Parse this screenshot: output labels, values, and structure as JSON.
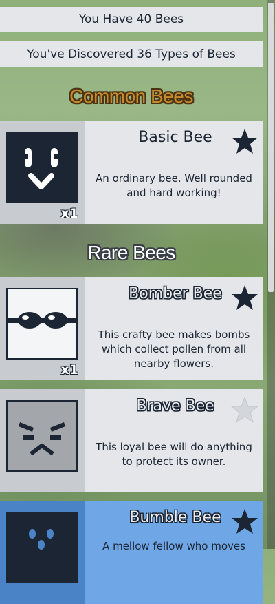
{
  "stats": {
    "bee_count_text": "You Have 40 Bees",
    "discovered_text": "You've Discovered 36 Types of Bees"
  },
  "sections": {
    "common_title": "Common Bees",
    "rare_title": "Rare Bees"
  },
  "bees": [
    {
      "name": "Basic Bee",
      "count": "x1",
      "description": "An ordinary bee. Well rounded and hard working!",
      "favorited": true,
      "icon": "basic-bee-face-icon"
    },
    {
      "name": "Bomber Bee",
      "count": "x1",
      "description": "This crafty bee makes bombs which collect pollen from all nearby flowers.",
      "favorited": true,
      "icon": "bomber-bee-goggles-icon"
    },
    {
      "name": "Brave Bee",
      "count": "",
      "description": "This loyal bee will do anything to protect its owner.",
      "favorited": false,
      "icon": "brave-bee-face-icon"
    },
    {
      "name": "Bumble Bee",
      "count": "",
      "description": "A mellow fellow who moves",
      "favorited": true,
      "icon": "bumble-bee-face-icon"
    }
  ],
  "colors": {
    "panel": "#e4e6e9",
    "icon_panel": "#c8ccd1",
    "dark": "#1c2533",
    "common_title": "#c98a2c",
    "bumble_panel": "#6ea6e6"
  }
}
